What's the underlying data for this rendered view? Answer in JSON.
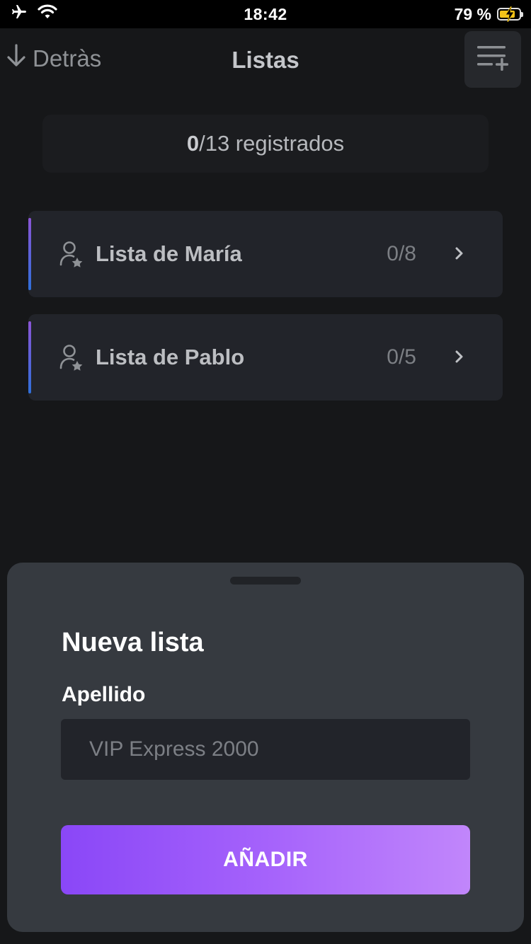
{
  "status_bar": {
    "time": "18:42",
    "battery_percent": "79 %",
    "battery_level": 0.79,
    "icons": [
      "airplane-icon",
      "wifi-icon",
      "battery-charging-icon"
    ]
  },
  "nav": {
    "back_label": "Detràs",
    "title": "Listas",
    "add_icon": "list-add-icon"
  },
  "summary": {
    "registered": "0",
    "rest": "/13 registrados"
  },
  "lists": [
    {
      "name": "Lista de María",
      "count": "0/8"
    },
    {
      "name": "Lista de Pablo",
      "count": "0/5"
    }
  ],
  "sheet": {
    "title": "Nueva lista",
    "field_label": "Apellido",
    "input_placeholder": "VIP Express 2000",
    "input_value": "",
    "button_label": "AÑADIR"
  },
  "colors": {
    "background": "#161719",
    "card": "#22242a",
    "sheet": "#363a40",
    "accent_start": "#8a47f7",
    "accent_end": "#c186fb",
    "battery": "#f2c318"
  }
}
